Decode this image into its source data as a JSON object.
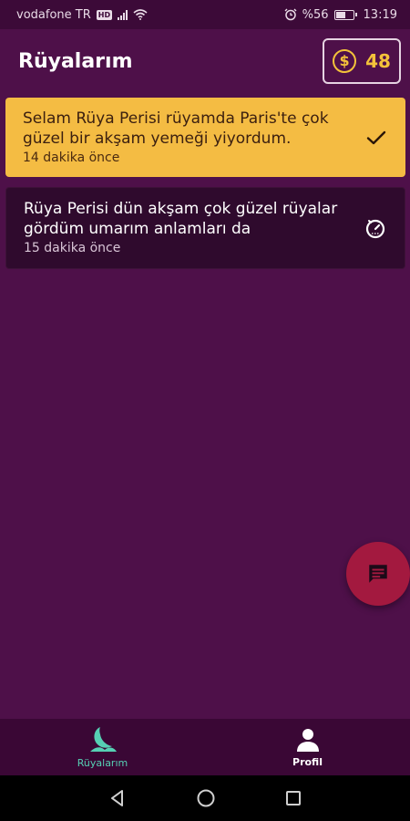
{
  "status_bar": {
    "carrier": "vodafone TR",
    "network_badge": "HD",
    "battery_text": "%56",
    "time": "13:19"
  },
  "header": {
    "title": "Rüyalarım",
    "coin_count": "48",
    "coin_symbol": "$"
  },
  "dreams": [
    {
      "text": "Selam Rüya Perisi rüyamda Paris'te çok güzel bir akşam yemeği yiyordum.",
      "time_ago": "14 dakika önce",
      "status_icon": "checkmark-icon",
      "state": "interpreted"
    },
    {
      "text": "Rüya Perisi dün akşam çok güzel rüyalar gördüm umarım anlamları da",
      "time_ago": "15 dakika önce",
      "status_icon": "timer-icon",
      "state": "pending"
    }
  ],
  "fab": {
    "icon": "chat-icon"
  },
  "bottom_nav": {
    "items": [
      {
        "label": "Rüyalarım",
        "icon": "moon-icon",
        "active": true
      },
      {
        "label": "Profil",
        "icon": "person-icon",
        "active": false
      }
    ]
  },
  "colors": {
    "background": "#4e1049",
    "active_card": "#f4bc43",
    "pending_card": "#2f0a2d",
    "fab": "#a3193f",
    "coin": "#f3c23a",
    "nav_active": "#56d0b4"
  }
}
